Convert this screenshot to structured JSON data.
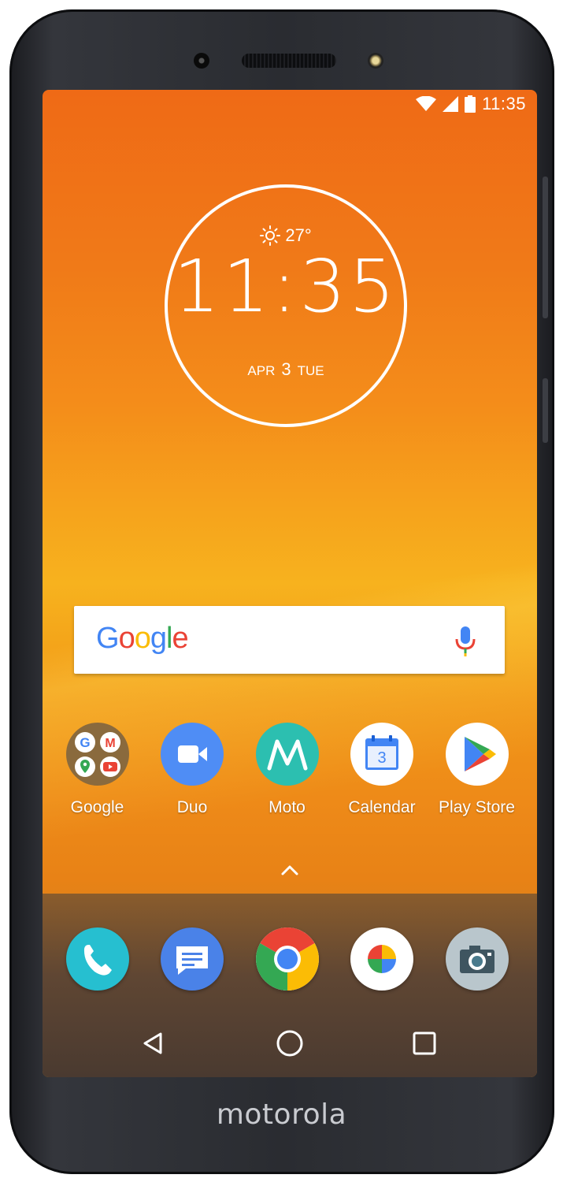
{
  "device": {
    "brand": "motorola"
  },
  "status_bar": {
    "time": "11:35"
  },
  "clock_widget": {
    "temperature": "27°",
    "time": "11:35",
    "month": "APR",
    "day": "3",
    "weekday": "TUE"
  },
  "search_bar": {
    "logo_text": "Google"
  },
  "apps": [
    {
      "label": "Google",
      "icon": "google-folder-icon"
    },
    {
      "label": "Duo",
      "icon": "duo-icon"
    },
    {
      "label": "Moto",
      "icon": "moto-icon"
    },
    {
      "label": "Calendar",
      "icon": "calendar-icon",
      "date": "3"
    },
    {
      "label": "Play Store",
      "icon": "play-store-icon"
    }
  ],
  "dock": [
    {
      "name": "Phone",
      "icon": "phone-icon"
    },
    {
      "name": "Messages",
      "icon": "messages-icon"
    },
    {
      "name": "Chrome",
      "icon": "chrome-icon"
    },
    {
      "name": "Photos",
      "icon": "photos-icon"
    },
    {
      "name": "Camera",
      "icon": "camera-icon"
    }
  ],
  "navigation": {
    "back": "back-icon",
    "home": "home-icon",
    "recents": "recents-icon"
  },
  "colors": {
    "google_blue": "#4285F4",
    "google_red": "#EA4335",
    "google_yellow": "#FBBC05",
    "google_green": "#34A853"
  }
}
